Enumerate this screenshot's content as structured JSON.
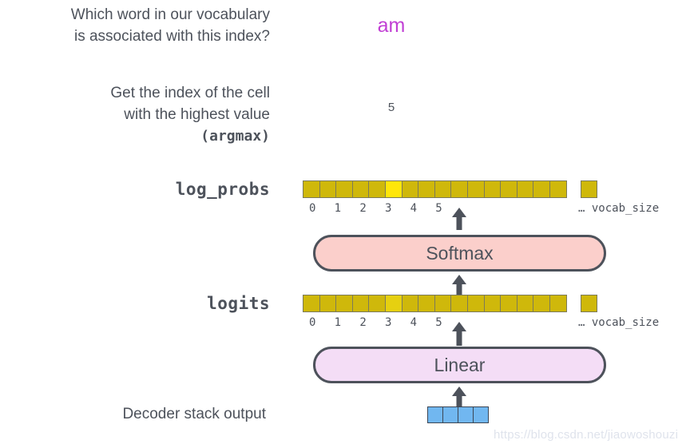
{
  "annotations": {
    "vocab_question": "Which word in our vocabulary\nis associated with this index?",
    "argmax_line1": "Get the index of the cell\nwith the highest value\n",
    "argmax_mono": "(argmax)"
  },
  "results": {
    "predicted_word": "am",
    "predicted_word_color": "#c13fd4",
    "predicted_index": "5"
  },
  "rows": {
    "log_probs": {
      "label": "log_probs",
      "cell_count": 16,
      "highlight_index": 5,
      "highlight_color": "#ffe60a",
      "base_color": "#cfb80b",
      "tick_labels": "0 1 2 3 4 5",
      "ellipsis": "…",
      "tail_label": "vocab_size"
    },
    "logits": {
      "label": "logits",
      "cell_count": 16,
      "highlight_index": 5,
      "highlight_color": "#e6d010",
      "base_color": "#cfb80b",
      "tick_labels": "0 1 2 3 4 5",
      "ellipsis": "…",
      "tail_label": "vocab_size"
    }
  },
  "operations": {
    "softmax": {
      "label": "Softmax",
      "fill": "#fbcfcb",
      "stroke": "#4d525b"
    },
    "linear": {
      "label": "Linear",
      "fill": "#f4ddf6",
      "stroke": "#4d525b"
    }
  },
  "decoder": {
    "label": "Decoder stack output",
    "cell_count": 4,
    "cell_color": "#71b7f0"
  },
  "watermark": "https://blog.csdn.net/jiaowoshouzi"
}
